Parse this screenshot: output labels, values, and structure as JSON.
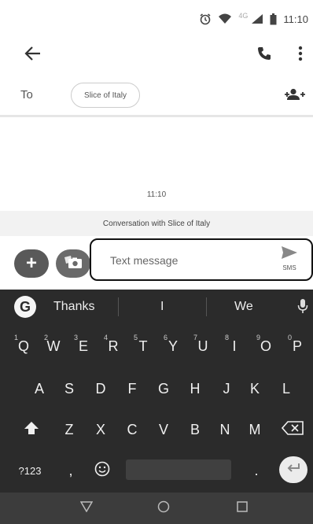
{
  "status_bar": {
    "network": "4G",
    "time": "11:10",
    "icons": [
      "alarm-icon",
      "wifi-icon",
      "signal-icon",
      "battery-icon"
    ]
  },
  "app_bar": {
    "icons": [
      "back-arrow-icon",
      "phone-icon",
      "more-vert-icon"
    ]
  },
  "recipient": {
    "to_label": "To",
    "chip": "Slice of Italy"
  },
  "conversation": {
    "timestamp": "11:10",
    "banner": "Conversation with Slice of Italy"
  },
  "compose": {
    "placeholder": "Text message",
    "value": "",
    "send_mode": "SMS"
  },
  "keyboard": {
    "suggestions": [
      "Thanks",
      "I",
      "We"
    ],
    "row1": [
      "Q",
      "W",
      "E",
      "R",
      "T",
      "Y",
      "U",
      "I",
      "O",
      "P"
    ],
    "row1_alt": [
      "1",
      "2",
      "3",
      "4",
      "5",
      "6",
      "7",
      "8",
      "9",
      "0"
    ],
    "row2": [
      "A",
      "S",
      "D",
      "F",
      "G",
      "H",
      "J",
      "K",
      "L"
    ],
    "row3": [
      "Z",
      "X",
      "C",
      "V",
      "B",
      "N",
      "M"
    ],
    "symbols_key": "?123",
    "comma_key": ",",
    "period_key": ".",
    "logo": "G"
  },
  "colors": {
    "keyboard_bg": "#2b2b2b",
    "nav_bg": "#3c3c3c",
    "compose_btn": "#595959"
  }
}
